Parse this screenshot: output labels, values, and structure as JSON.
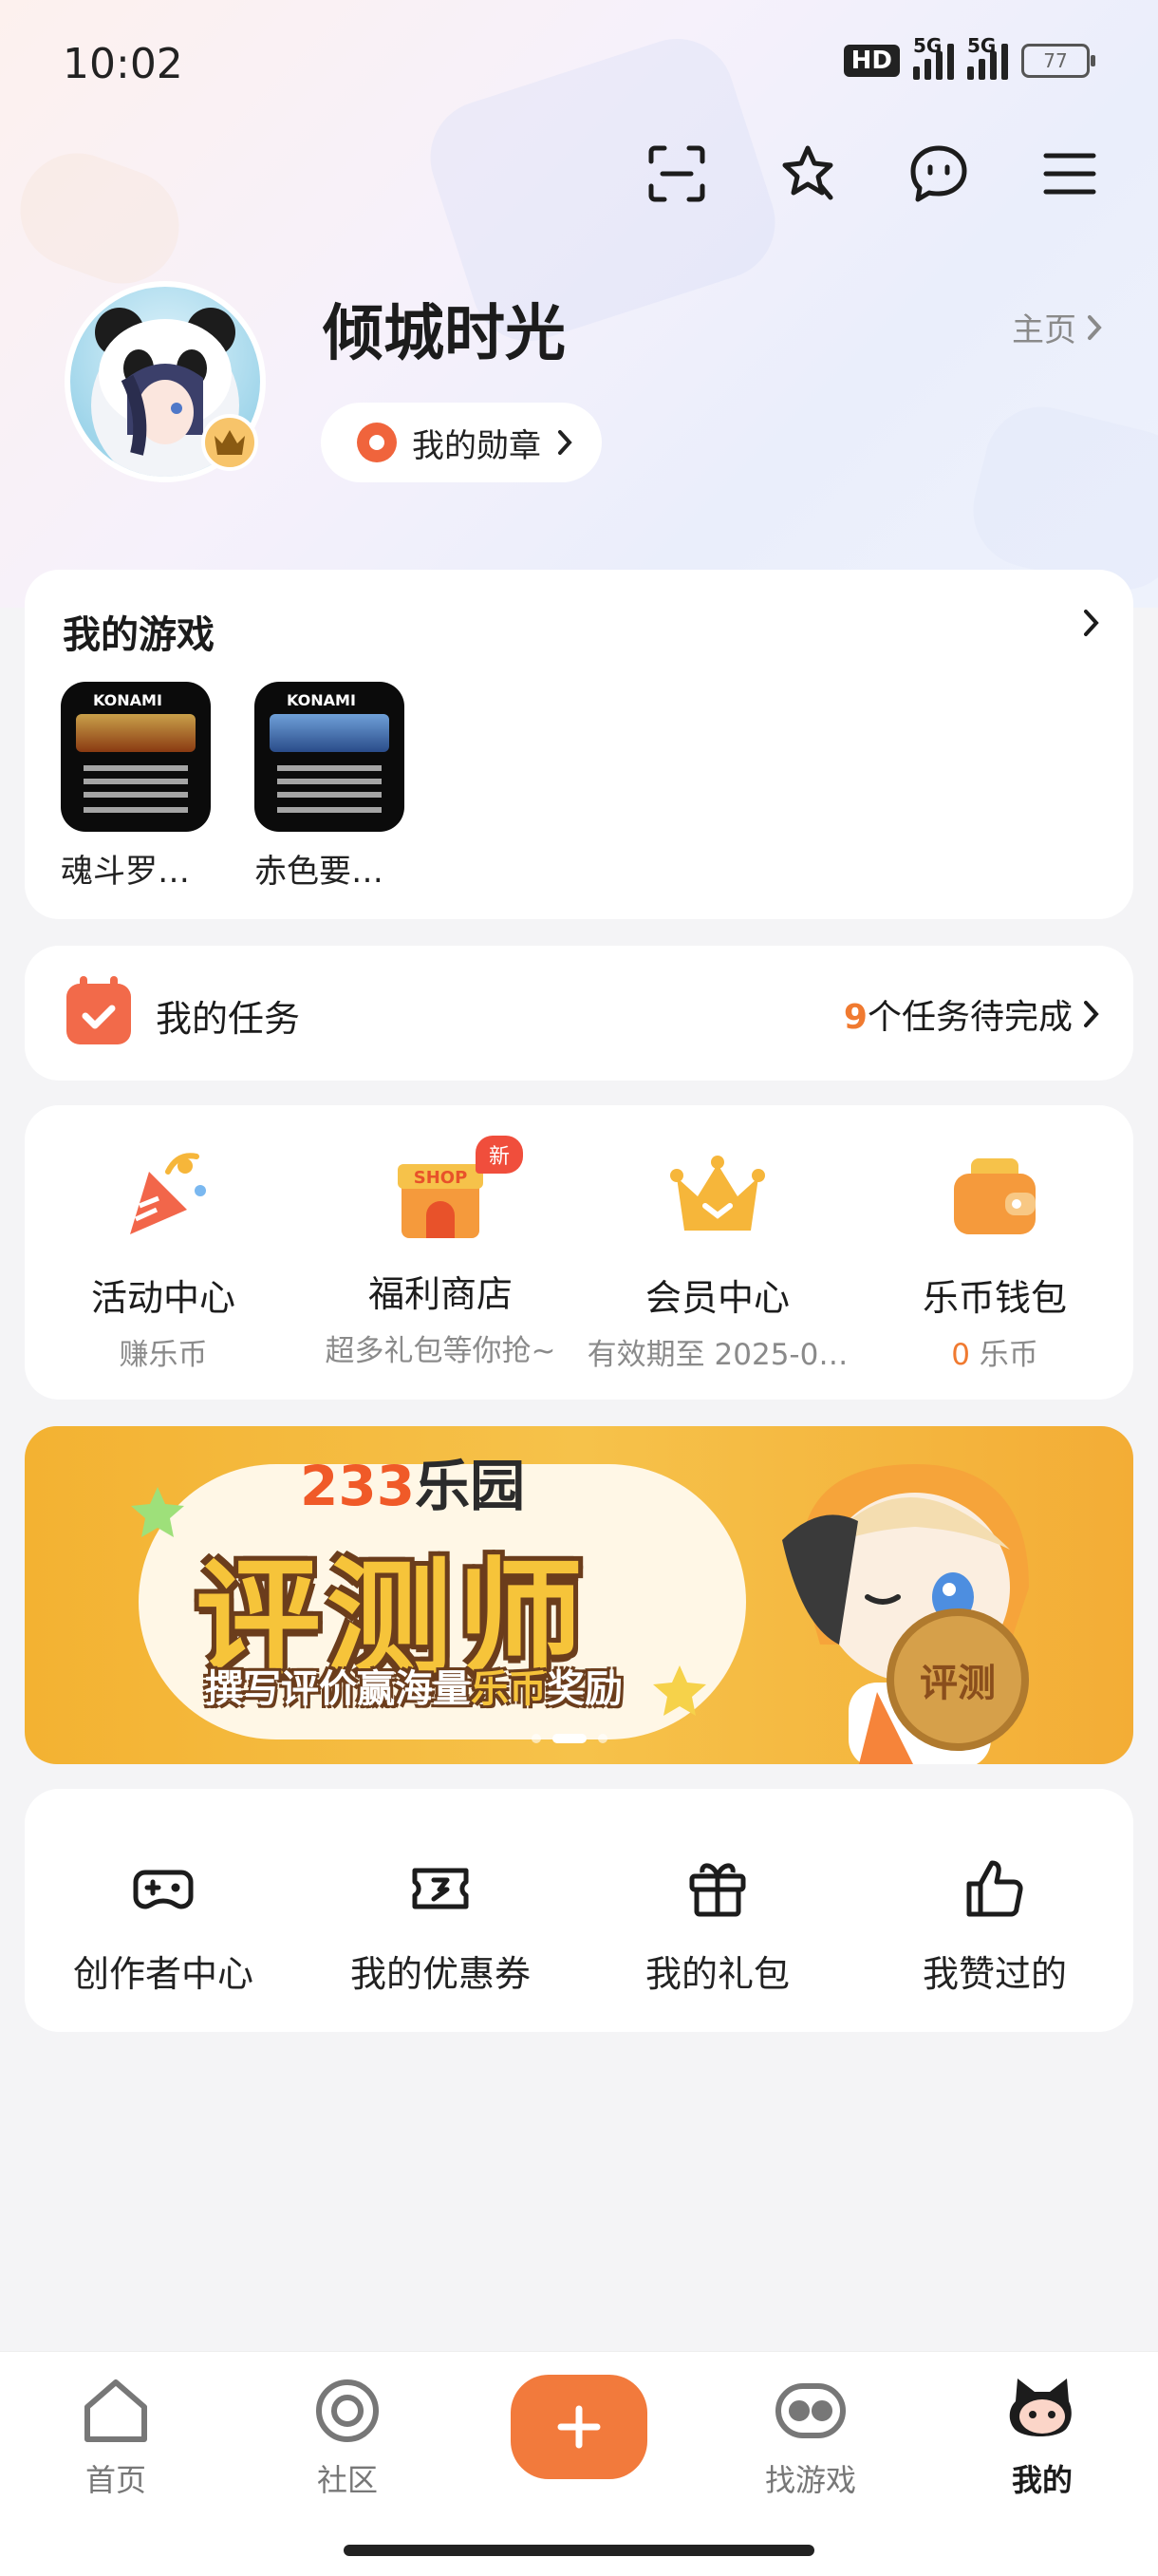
{
  "status_bar": {
    "time": "10:02",
    "hd": "HD",
    "net1": "5G",
    "net2": "5G",
    "battery": "77"
  },
  "top_icons": [
    "scan-icon",
    "star-sparkle-icon",
    "message-icon",
    "menu-icon"
  ],
  "profile": {
    "username": "倾城时光",
    "homepage_label": "主页",
    "medal_button": "我的勋章"
  },
  "games": {
    "title": "我的游戏",
    "items": [
      {
        "name": "魂斗罗…"
      },
      {
        "name": "赤色要…"
      }
    ]
  },
  "tasks": {
    "label": "我的任务",
    "count": "9",
    "suffix": "个任务待完成"
  },
  "services": [
    {
      "name": "活动中心",
      "sub": "赚乐币",
      "icon": "party-popper-icon"
    },
    {
      "name": "福利商店",
      "sub": "超多礼包等你抢~",
      "icon": "shop-icon",
      "badge": "新",
      "badge_text": "SHOP"
    },
    {
      "name": "会员中心",
      "sub": "有效期至 2025-0…",
      "icon": "crown-icon"
    },
    {
      "name": "乐币钱包",
      "sub_value": "0",
      "sub_unit": "乐币",
      "icon": "wallet-icon"
    }
  ],
  "banner": {
    "brand_num": "233",
    "brand_text": "乐园",
    "headline": "评测师",
    "subline_a": "撰写评价赢海量",
    "subline_hl": "乐币",
    "subline_b": "奖励",
    "coin_text": "评测",
    "active_dot": 1
  },
  "tools": [
    {
      "name": "创作者中心",
      "icon": "gamepad-plus-icon"
    },
    {
      "name": "我的优惠券",
      "icon": "ticket-icon"
    },
    {
      "name": "我的礼包",
      "icon": "gift-icon"
    },
    {
      "name": "我赞过的",
      "icon": "thumbs-up-icon"
    }
  ],
  "tabbar": [
    {
      "label": "首页",
      "icon": "home-icon"
    },
    {
      "label": "社区",
      "icon": "community-icon"
    },
    {
      "label": "",
      "icon": "plus-icon"
    },
    {
      "label": "找游戏",
      "icon": "find-game-icon"
    },
    {
      "label": "我的",
      "icon": "mine-icon",
      "active": true
    }
  ],
  "colors": {
    "accent": "#f27a3c",
    "badge": "#f04e3c",
    "banner": "#f6c24a"
  }
}
